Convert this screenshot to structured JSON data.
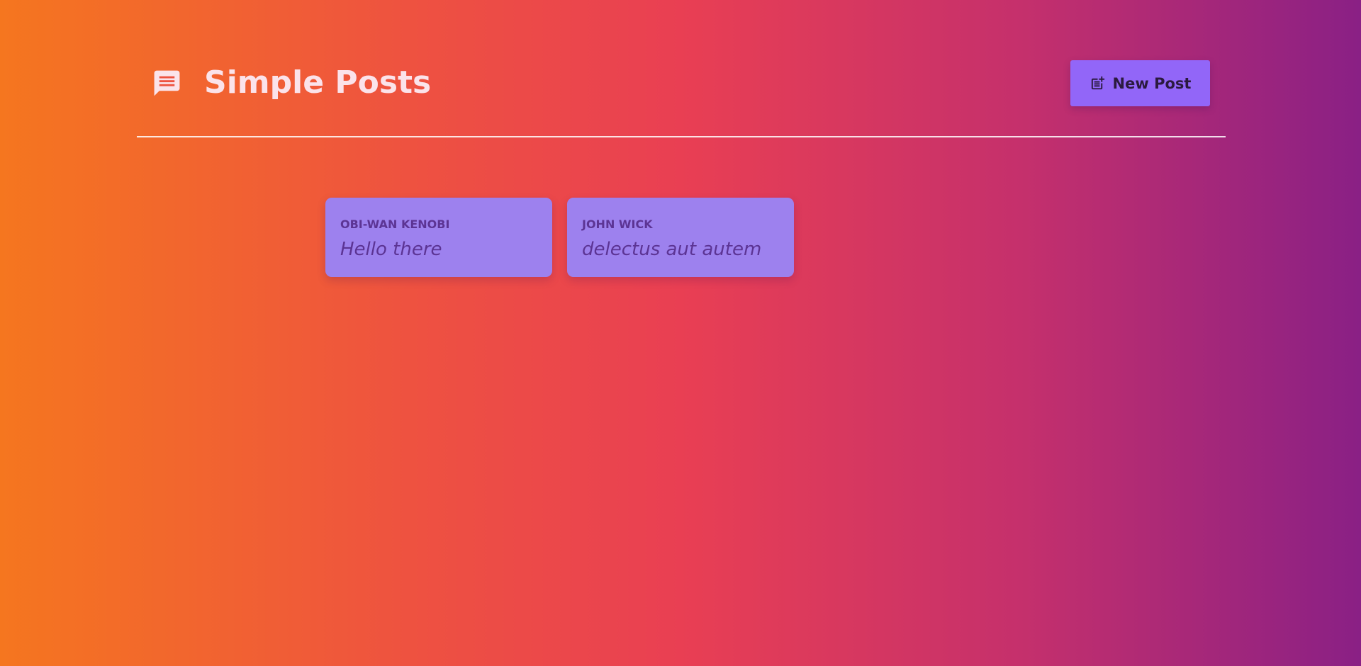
{
  "header": {
    "icon": "chat-icon",
    "title": "Simple Posts",
    "new_post_label": "New Post",
    "new_post_icon": "post-add-icon"
  },
  "posts": [
    {
      "author": "OBI-WAN KENOBI",
      "body": "Hello there"
    },
    {
      "author": "JOHN WICK",
      "body": "delectus aut autem"
    }
  ],
  "colors": {
    "gradient_start": "#f5761f",
    "gradient_mid": "#e93f53",
    "gradient_end": "#8a2085",
    "accent_button": "#9266f8",
    "card": "#9d81ee",
    "card_text": "#5c3494",
    "title_text": "#fbe3ea"
  }
}
